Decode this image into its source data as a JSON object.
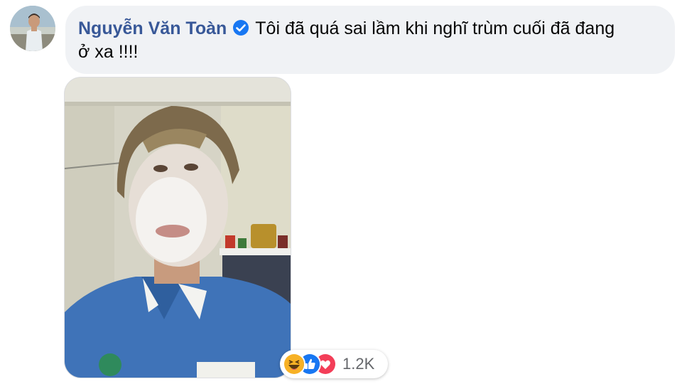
{
  "comment": {
    "author": "Nguyễn Văn Toàn",
    "verified": true,
    "text_line1": "Tôi đã quá sai lầm khi nghĩ trùm cuối đã đang",
    "text_line2": "ở xa !!!!"
  },
  "reactions": {
    "icons": [
      "haha-icon",
      "like-icon",
      "love-icon"
    ],
    "count": "1.2K"
  },
  "colors": {
    "author": "#385898",
    "bubble": "#f0f2f5",
    "verified": "#1877f2",
    "like": "#1877f2",
    "love": "#f33e58",
    "haha": "#f7b125"
  }
}
